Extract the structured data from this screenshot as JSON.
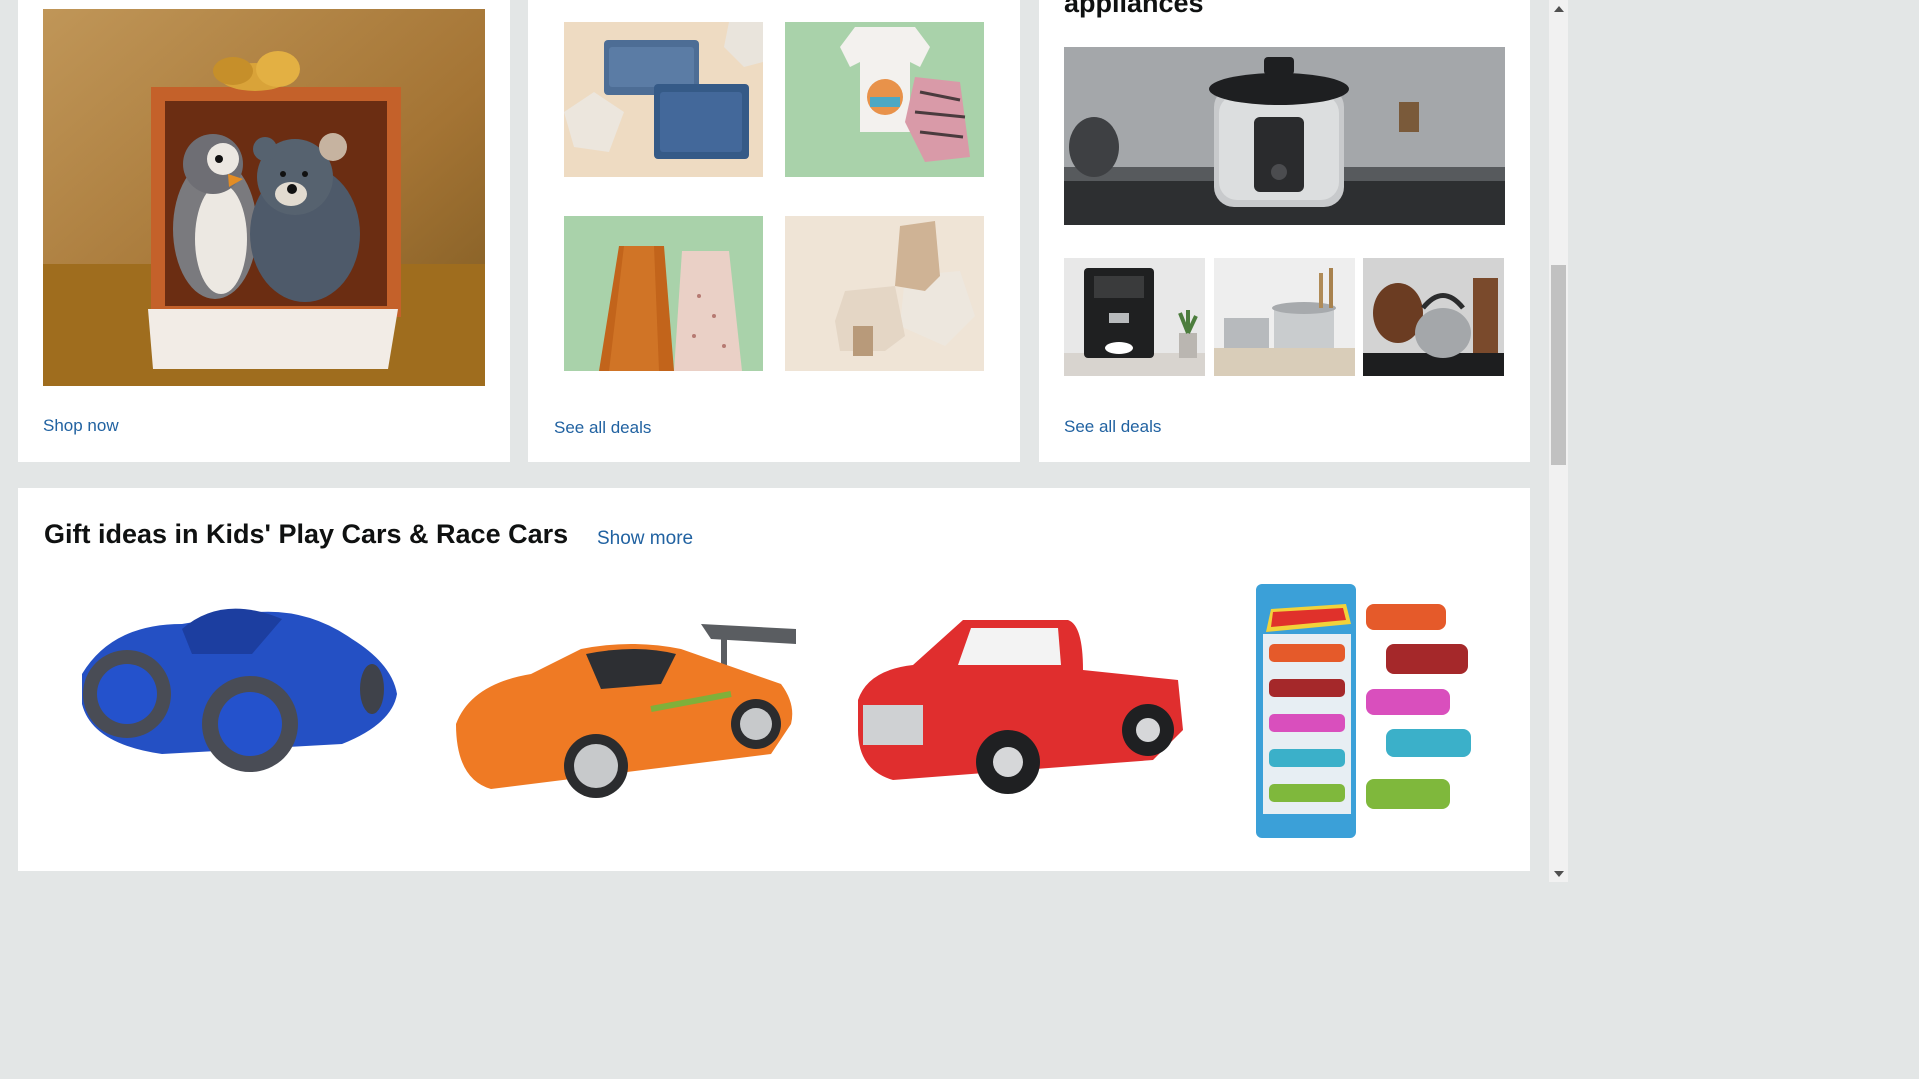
{
  "cards": {
    "gift": {
      "link": "Shop now"
    },
    "fashion": {
      "link": "See all deals"
    },
    "appliances": {
      "title": "appliances",
      "link": "See all deals"
    }
  },
  "row": {
    "title": "Gift ideas in Kids' Play Cars & Race Cars",
    "show_more": "Show more"
  },
  "colors": {
    "background": "#e3e6e6",
    "link": "#2162a1",
    "title": "#0f1111"
  }
}
